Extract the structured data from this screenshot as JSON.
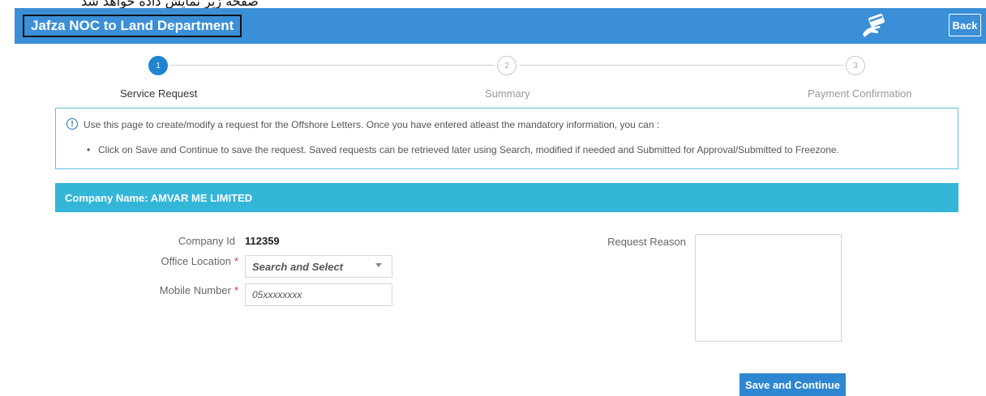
{
  "overlay_caption": "صفحه زیر نمایش داده خواهد شد",
  "header": {
    "title": "Jafza NOC to Land Department",
    "back_label": "Back"
  },
  "stepper": {
    "steps": [
      {
        "number": "1",
        "label": "Service Request",
        "state": "active"
      },
      {
        "number": "2",
        "label": "Summary",
        "state": "inactive"
      },
      {
        "number": "3",
        "label": "Payment Confirmation",
        "state": "inactive"
      }
    ]
  },
  "info": {
    "line1": "Use this page to create/modify a request for the Offshore Letters. Once you have entered atleast the mandatory information, you can :",
    "bullet1": "Click on Save and Continue to save the request. Saved requests can be retrieved later using Search, modified if needed and Submitted for Approval/Submitted to Freezone."
  },
  "company": {
    "name_label": "Company Name: AMVAR ME LIMITED"
  },
  "form": {
    "company_id_label": "Company Id",
    "company_id_value": "112359",
    "office_location_label": "Office Location",
    "office_location_value": "Search and Select",
    "mobile_label": "Mobile Number",
    "mobile_placeholder": "05xxxxxxxx",
    "required_marker": "*",
    "request_reason_label": "Request Reason"
  },
  "actions": {
    "save_label": "Save and Continue"
  },
  "colors": {
    "header_bg": "#3a8fd6",
    "company_bar_bg": "#34b6d8",
    "step_active": "#1f84d2",
    "button_bg": "#2e86d0"
  }
}
